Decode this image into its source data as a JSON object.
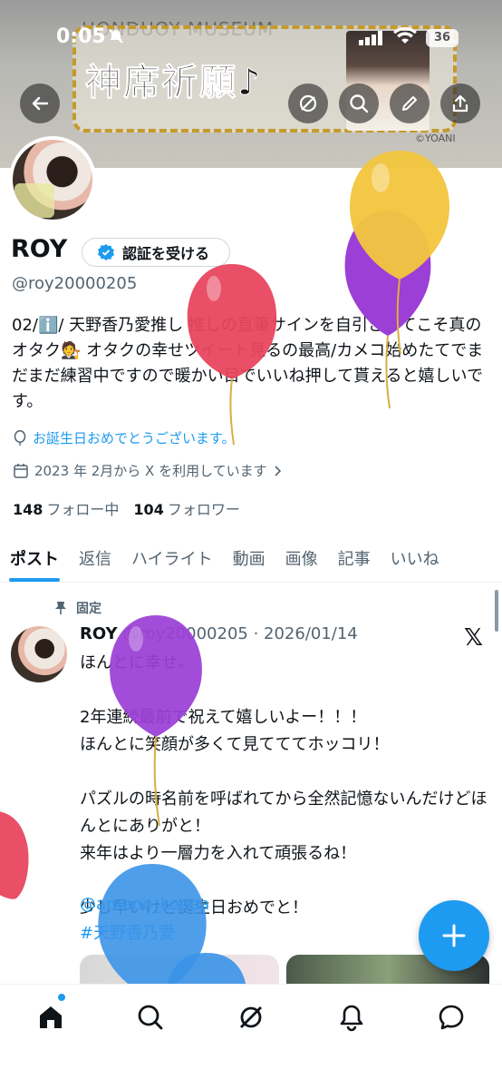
{
  "status_bar": {
    "time": "0:05",
    "battery": "36"
  },
  "banner": {
    "museum_text": "HONDUOY MUSEUM",
    "sign_text": "神席祈願♪",
    "credit": "©YOANI"
  },
  "profile": {
    "name": "ROY",
    "verify_label": "認証を受ける",
    "handle": "@roy20000205",
    "bio": "02/ℹ️/ 天野香乃愛推し 推しの直筆サインを自引きしてこそ真のオタク🧑‍⚖️ オタクの幸せツイート見るの最高/カメコ始めたてでまだまだ練習中ですので暖かい目でいいね押して貰えると嬉しいです。",
    "birthday": "お誕生日おめでとうございます。",
    "joined": "2023 年 2月から X を利用しています",
    "following_count": "148",
    "following_label": "フォロー中",
    "followers_count": "104",
    "followers_label": "フォロワー"
  },
  "tabs": [
    "ポスト",
    "返信",
    "ハイライト",
    "動画",
    "画像",
    "記事",
    "いいね"
  ],
  "tweet": {
    "pinned_label": "固定",
    "name": "ROY",
    "handle_date": "@roy20000205 · 2026/01/14",
    "body": "ほんとに幸せ。\n\n2年連続最前で祝えて嬉しいよー！！！\nほんとに笑顔が多くて見てててホッコリ！\n\nパズルの時名前を呼ばれてから全然記憶ないんだけどほんとにありがと！\n来年はより一層力を入れて頑張るね！\n\n少し早いけど誕生日おめでと！",
    "mention": "@amano_konoa",
    "hashtag": "#天野香乃愛"
  },
  "colors": {
    "accent": "#1d9bf0",
    "balloon_yellow": "#f3c63f",
    "balloon_purple": "#9b3fd6",
    "balloon_red": "#e8465e",
    "balloon_blue": "#3b94e8"
  },
  "icons": [
    "back-arrow-icon",
    "grok-icon",
    "search-icon",
    "edit-icon",
    "share-icon",
    "verified-badge-icon",
    "balloon-icon",
    "calendar-icon",
    "pin-icon",
    "x-logo-icon",
    "plus-icon",
    "home-icon",
    "bell-icon",
    "message-icon"
  ]
}
